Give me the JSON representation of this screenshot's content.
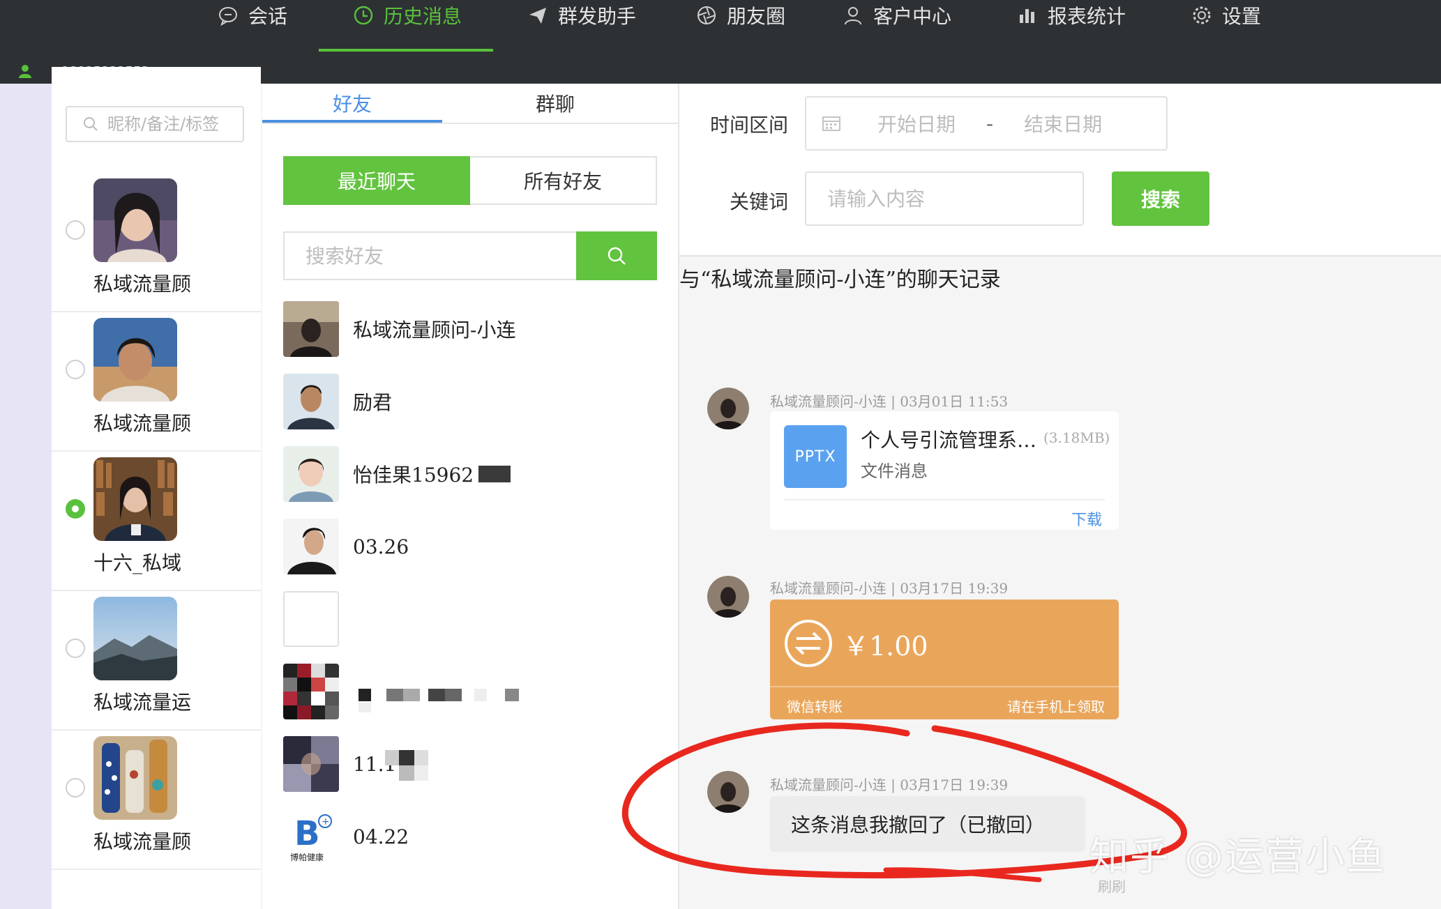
{
  "nav": {
    "items": [
      {
        "label": "会话",
        "icon": "chat-bubble-icon"
      },
      {
        "label": "历史消息",
        "icon": "clock-icon",
        "active": true
      },
      {
        "label": "群发助手",
        "icon": "send-icon"
      },
      {
        "label": "朋友圈",
        "icon": "aperture-icon"
      },
      {
        "label": "客户中心",
        "icon": "person-icon"
      },
      {
        "label": "报表统计",
        "icon": "bar-chart-icon"
      },
      {
        "label": "设置",
        "icon": "gear-icon"
      }
    ],
    "active_color": "#59c13c",
    "user_id_partial": "18925222552"
  },
  "accounts": {
    "search_placeholder": "昵称/备注/标签",
    "items": [
      {
        "name": "私域流量顾",
        "selected": false
      },
      {
        "name": "私域流量顾",
        "selected": false
      },
      {
        "name": "十六_私域",
        "selected": true
      },
      {
        "name": "私域流量运",
        "selected": false
      },
      {
        "name": "私域流量顾",
        "selected": false
      }
    ]
  },
  "friends": {
    "tabs": [
      {
        "label": "好友",
        "active": true
      },
      {
        "label": "群聊",
        "active": false
      }
    ],
    "segments": [
      {
        "label": "最近聊天",
        "active": true
      },
      {
        "label": "所有好友",
        "active": false
      }
    ],
    "search_placeholder": "搜索好友",
    "list": [
      {
        "name": "私域流量顾问-小连"
      },
      {
        "name": "励君"
      },
      {
        "name": "怡佳果15962"
      },
      {
        "name": "03.26"
      },
      {
        "name": ""
      },
      {
        "name": ""
      },
      {
        "name": "11.1"
      },
      {
        "name": "04.22",
        "logo_text": "博帕健康"
      }
    ]
  },
  "filters": {
    "time_label": "时间区间",
    "start_placeholder": "开始日期",
    "separator": "-",
    "end_placeholder": "结束日期",
    "keyword_label": "关键词",
    "keyword_placeholder": "请输入内容",
    "search_label": "搜索"
  },
  "history": {
    "title": "与“私域流量顾问-小连”的聊天记录",
    "messages": [
      {
        "meta": "私域流量顾问-小连 | 03月01日 11:53",
        "type": "file",
        "file_icon": "PPTX",
        "file_name": "个人号引流管理系…",
        "file_size": "(3.18MB)",
        "file_type": "文件消息",
        "download": "下载"
      },
      {
        "meta": "私域流量顾问-小连 | 03月17日 19:39",
        "type": "transfer",
        "amount": "￥1.00",
        "label": "微信转账",
        "hint": "请在手机上领取",
        "color": "#e9a65b"
      },
      {
        "meta": "私域流量顾问-小连 | 03月17日 19:39",
        "type": "text",
        "text": "这条消息我撤回了（已撤回）"
      }
    ],
    "more": "刷刷"
  },
  "watermark": "知乎 @运营小鱼",
  "colors": {
    "green": "#62c33f",
    "blue": "#4a90e2",
    "annotation_red": "#e8281e"
  }
}
